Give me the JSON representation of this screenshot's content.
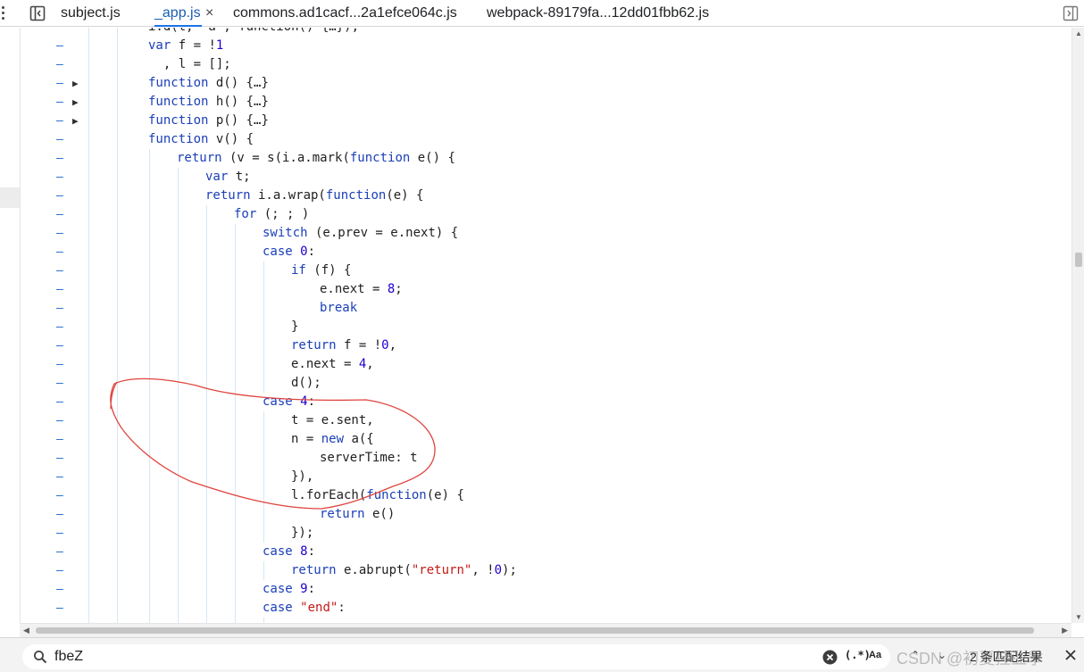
{
  "tabs": [
    {
      "label": "subject.js",
      "active": false,
      "closable": false
    },
    {
      "label": "_app.js",
      "active": true,
      "closable": true
    },
    {
      "label": "commons.ad1cacf...2a1efce064c.js",
      "active": false,
      "closable": false
    },
    {
      "label": "webpack-89179fa...12dd01fbb62.js",
      "active": false,
      "closable": false
    }
  ],
  "icons": {
    "menu": "kebab-menu-icon",
    "sidebar": "sidebar-toggle-icon",
    "close_tab": "close-icon",
    "panel": "panel-toggle-icon",
    "search": "search-icon",
    "clear": "clear-icon",
    "prev": "chevron-up-icon",
    "next": "chevron-down-icon",
    "close_search": "close-icon"
  },
  "tab_close_glyph": "×",
  "gutter_marker": "–",
  "fold_glyph": "▶",
  "code_lines": [
    {
      "indent": 0,
      "fold": false,
      "tokens": [
        {
          "t": "i.d(t, \"a\", function() {…});",
          "c": ""
        }
      ]
    },
    {
      "indent": 0,
      "fold": false,
      "tokens": [
        {
          "t": "var",
          "c": "k"
        },
        {
          "t": " f = !",
          "c": ""
        },
        {
          "t": "1",
          "c": "n"
        }
      ]
    },
    {
      "indent": 0,
      "fold": false,
      "tokens": [
        {
          "t": "  , l = [];",
          "c": ""
        }
      ]
    },
    {
      "indent": 0,
      "fold": true,
      "tokens": [
        {
          "t": "function",
          "c": "k"
        },
        {
          "t": " d() {…}",
          "c": ""
        }
      ]
    },
    {
      "indent": 0,
      "fold": true,
      "tokens": [
        {
          "t": "function",
          "c": "k"
        },
        {
          "t": " h() {…}",
          "c": ""
        }
      ]
    },
    {
      "indent": 0,
      "fold": true,
      "tokens": [
        {
          "t": "function",
          "c": "k"
        },
        {
          "t": " p() {…}",
          "c": ""
        }
      ]
    },
    {
      "indent": 0,
      "fold": false,
      "tokens": [
        {
          "t": "function",
          "c": "k"
        },
        {
          "t": " v() {",
          "c": ""
        }
      ]
    },
    {
      "indent": 1,
      "fold": false,
      "tokens": [
        {
          "t": "return",
          "c": "k"
        },
        {
          "t": " (v = s(i.a.mark(",
          "c": ""
        },
        {
          "t": "function",
          "c": "k"
        },
        {
          "t": " e() {",
          "c": ""
        }
      ]
    },
    {
      "indent": 2,
      "fold": false,
      "tokens": [
        {
          "t": "var",
          "c": "k"
        },
        {
          "t": " t;",
          "c": ""
        }
      ]
    },
    {
      "indent": 2,
      "fold": false,
      "tokens": [
        {
          "t": "return",
          "c": "k"
        },
        {
          "t": " i.a.wrap(",
          "c": ""
        },
        {
          "t": "function",
          "c": "k"
        },
        {
          "t": "(e) {",
          "c": ""
        }
      ]
    },
    {
      "indent": 3,
      "fold": false,
      "tokens": [
        {
          "t": "for",
          "c": "k"
        },
        {
          "t": " (; ; )",
          "c": ""
        }
      ]
    },
    {
      "indent": 4,
      "fold": false,
      "tokens": [
        {
          "t": "switch",
          "c": "k"
        },
        {
          "t": " (e.prev = e.next) {",
          "c": ""
        }
      ]
    },
    {
      "indent": 4,
      "fold": false,
      "tokens": [
        {
          "t": "case",
          "c": "k"
        },
        {
          "t": " ",
          "c": ""
        },
        {
          "t": "0",
          "c": "n"
        },
        {
          "t": ":",
          "c": ""
        }
      ]
    },
    {
      "indent": 5,
      "fold": false,
      "tokens": [
        {
          "t": "if",
          "c": "k"
        },
        {
          "t": " (f) {",
          "c": ""
        }
      ]
    },
    {
      "indent": 6,
      "fold": false,
      "tokens": [
        {
          "t": "e.next = ",
          "c": ""
        },
        {
          "t": "8",
          "c": "n"
        },
        {
          "t": ";",
          "c": ""
        }
      ]
    },
    {
      "indent": 6,
      "fold": false,
      "tokens": [
        {
          "t": "break",
          "c": "k"
        }
      ]
    },
    {
      "indent": 5,
      "fold": false,
      "tokens": [
        {
          "t": "}",
          "c": ""
        }
      ]
    },
    {
      "indent": 5,
      "fold": false,
      "tokens": [
        {
          "t": "return",
          "c": "k"
        },
        {
          "t": " f = !",
          "c": ""
        },
        {
          "t": "0",
          "c": "n"
        },
        {
          "t": ",",
          "c": ""
        }
      ]
    },
    {
      "indent": 5,
      "fold": false,
      "tokens": [
        {
          "t": "e.next = ",
          "c": ""
        },
        {
          "t": "4",
          "c": "n"
        },
        {
          "t": ",",
          "c": ""
        }
      ]
    },
    {
      "indent": 5,
      "fold": false,
      "tokens": [
        {
          "t": "d();",
          "c": ""
        }
      ]
    },
    {
      "indent": 4,
      "fold": false,
      "tokens": [
        {
          "t": "case",
          "c": "k"
        },
        {
          "t": " ",
          "c": ""
        },
        {
          "t": "4",
          "c": "n"
        },
        {
          "t": ":",
          "c": ""
        }
      ]
    },
    {
      "indent": 5,
      "fold": false,
      "tokens": [
        {
          "t": "t = e.sent,",
          "c": ""
        }
      ]
    },
    {
      "indent": 5,
      "fold": false,
      "tokens": [
        {
          "t": "n = ",
          "c": ""
        },
        {
          "t": "new",
          "c": "k"
        },
        {
          "t": " a({",
          "c": ""
        }
      ]
    },
    {
      "indent": 6,
      "fold": false,
      "tokens": [
        {
          "t": "serverTime: t",
          "c": ""
        }
      ]
    },
    {
      "indent": 5,
      "fold": false,
      "tokens": [
        {
          "t": "}),",
          "c": ""
        }
      ]
    },
    {
      "indent": 5,
      "fold": false,
      "tokens": [
        {
          "t": "l.forEach(",
          "c": ""
        },
        {
          "t": "function",
          "c": "k"
        },
        {
          "t": "(e) {",
          "c": ""
        }
      ]
    },
    {
      "indent": 6,
      "fold": false,
      "tokens": [
        {
          "t": "return",
          "c": "k"
        },
        {
          "t": " e()",
          "c": ""
        }
      ]
    },
    {
      "indent": 5,
      "fold": false,
      "tokens": [
        {
          "t": "});",
          "c": ""
        }
      ]
    },
    {
      "indent": 4,
      "fold": false,
      "tokens": [
        {
          "t": "case",
          "c": "k"
        },
        {
          "t": " ",
          "c": ""
        },
        {
          "t": "8",
          "c": "n"
        },
        {
          "t": ":",
          "c": ""
        }
      ]
    },
    {
      "indent": 5,
      "fold": false,
      "tokens": [
        {
          "t": "return",
          "c": "k"
        },
        {
          "t": " e.abrupt(",
          "c": ""
        },
        {
          "t": "\"return\"",
          "c": "s"
        },
        {
          "t": ", !",
          "c": ""
        },
        {
          "t": "0",
          "c": "n"
        },
        {
          "t": ");",
          "c": ""
        }
      ]
    },
    {
      "indent": 4,
      "fold": false,
      "tokens": [
        {
          "t": "case",
          "c": "k"
        },
        {
          "t": " ",
          "c": ""
        },
        {
          "t": "9",
          "c": "n"
        },
        {
          "t": ":",
          "c": ""
        }
      ]
    },
    {
      "indent": 4,
      "fold": false,
      "tokens": [
        {
          "t": "case",
          "c": "k"
        },
        {
          "t": " ",
          "c": ""
        },
        {
          "t": "\"end\"",
          "c": "s"
        },
        {
          "t": ":",
          "c": ""
        }
      ]
    },
    {
      "indent": 5,
      "fold": false,
      "tokens": [
        {
          "t": "    ...",
          "c": ""
        }
      ]
    }
  ],
  "search": {
    "query": "fbeZ",
    "regex_label": "(.*)",
    "case_label": "Aa",
    "prev_glyph": "⌃",
    "next_glyph": "⌄",
    "match_count": "2 条匹配结果"
  },
  "scroll_glyphs": {
    "up": "▲",
    "down": "▼",
    "left": "◀",
    "right": "▶"
  },
  "watermark": "CSDN @初夏挂业季",
  "colors": {
    "accent": "#1a73e8",
    "keyword": "#1a3fb8",
    "number": "#1c00cf",
    "string": "#c41a16",
    "annotation": "#e0443e"
  }
}
